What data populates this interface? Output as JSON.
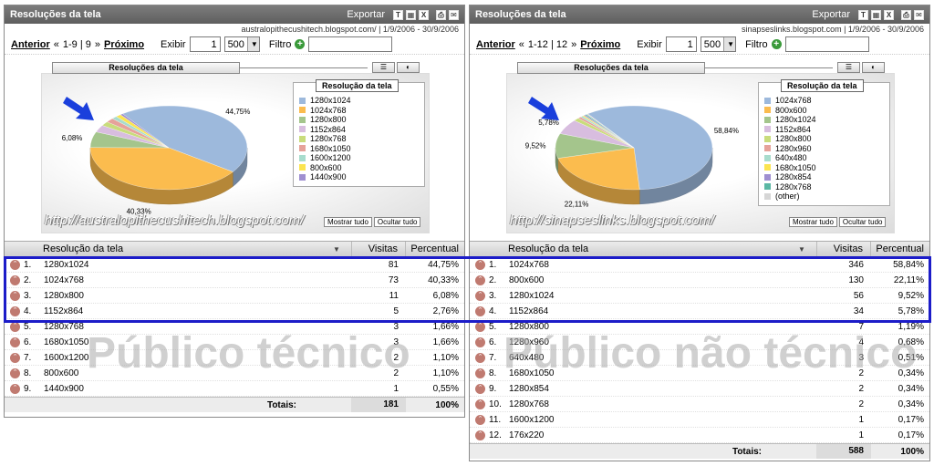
{
  "colors": {
    "highlight": "#1c1cc8",
    "arrow": "#1a3fdc",
    "pie_blue": "#9db9dc",
    "pie_orange": "#fbbc4e",
    "pie_green": "#a4c58c",
    "pie_lilac": "#d8bddf",
    "pie_yellowgreen": "#c9dc7c",
    "pie_salmon": "#e6a29a",
    "pie_mint": "#a8dccd",
    "pie_yellow": "#fbe450",
    "pie_purple": "#9f8fd0",
    "pie_teal": "#5bb8a4",
    "pie_grey": "#d6d6d6"
  },
  "panels": [
    {
      "title": "Resoluções da tela",
      "export_label": "Exportar",
      "toolbar_icons": [
        "text-export-icon",
        "chart-export-icon",
        "xls-export-icon",
        "print-icon",
        "email-icon"
      ],
      "site": "australopithecushitech.blogspot.com/",
      "date_range": "1/9/2006 - 30/9/2006",
      "nav": {
        "prev": "Anterior",
        "range": "1-9 | 9",
        "next": "Próximo",
        "show_label": "Exibir",
        "show_value": "1",
        "page_size": "500",
        "filter_label": "Filtro",
        "filter_value": ""
      },
      "chart_title": "Resoluções da tela",
      "legend_title": "Resolução da tela",
      "legend_buttons": [
        "Mostrar tudo",
        "Ocultar tudo"
      ],
      "watermark_url": "http://australopithecushitech.blogspot.com/",
      "slice_labels": [
        {
          "text": "44,75%"
        },
        {
          "text": "40,33%"
        },
        {
          "text": "6,08%"
        }
      ],
      "table_headers": {
        "name": "Resolução da tela",
        "visits": "Visitas",
        "percent": "Percentual"
      },
      "rows": [
        {
          "rank": "1.",
          "name": "1280x1024",
          "visits": "81",
          "pct": "44,75%"
        },
        {
          "rank": "2.",
          "name": "1024x768",
          "visits": "73",
          "pct": "40,33%"
        },
        {
          "rank": "3.",
          "name": "1280x800",
          "visits": "11",
          "pct": "6,08%"
        },
        {
          "rank": "4.",
          "name": "1152x864",
          "visits": "5",
          "pct": "2,76%"
        },
        {
          "rank": "5.",
          "name": "1280x768",
          "visits": "3",
          "pct": "1,66%"
        },
        {
          "rank": "6.",
          "name": "1680x1050",
          "visits": "3",
          "pct": "1,66%"
        },
        {
          "rank": "7.",
          "name": "1600x1200",
          "visits": "2",
          "pct": "1,10%"
        },
        {
          "rank": "8.",
          "name": "800x600",
          "visits": "2",
          "pct": "1,10%"
        },
        {
          "rank": "9.",
          "name": "1440x900",
          "visits": "1",
          "pct": "0,55%"
        }
      ],
      "totals": {
        "label": "Totais:",
        "visits": "181",
        "pct": "100%"
      },
      "big_label": "Público técnico"
    },
    {
      "title": "Resoluções da tela",
      "export_label": "Exportar",
      "toolbar_icons": [
        "text-export-icon",
        "chart-export-icon",
        "xls-export-icon",
        "print-icon",
        "email-icon"
      ],
      "site": "sinapseslinks.blogspot.com",
      "date_range": "1/9/2006 - 30/9/2006",
      "nav": {
        "prev": "Anterior",
        "range": "1-12 | 12",
        "next": "Próximo",
        "show_label": "Exibir",
        "show_value": "1",
        "page_size": "500",
        "filter_label": "Filtro",
        "filter_value": ""
      },
      "chart_title": "Resoluções da tela",
      "legend_title": "Resolução da tela",
      "legend_buttons": [
        "Mostrar tudo",
        "Ocultar tudo"
      ],
      "watermark_url": "http://sinapseslinks.blogspot.com/",
      "slice_labels": [
        {
          "text": "58,84%"
        },
        {
          "text": "22,11%"
        },
        {
          "text": "9,52%"
        },
        {
          "text": "5,78%"
        }
      ],
      "table_headers": {
        "name": "Resolução da tela",
        "visits": "Visitas",
        "percent": "Percentual"
      },
      "rows": [
        {
          "rank": "1.",
          "name": "1024x768",
          "visits": "346",
          "pct": "58,84%"
        },
        {
          "rank": "2.",
          "name": "800x600",
          "visits": "130",
          "pct": "22,11%"
        },
        {
          "rank": "3.",
          "name": "1280x1024",
          "visits": "56",
          "pct": "9,52%"
        },
        {
          "rank": "4.",
          "name": "1152x864",
          "visits": "34",
          "pct": "5,78%"
        },
        {
          "rank": "5.",
          "name": "1280x800",
          "visits": "7",
          "pct": "1,19%"
        },
        {
          "rank": "6.",
          "name": "1280x960",
          "visits": "4",
          "pct": "0,68%"
        },
        {
          "rank": "7.",
          "name": "640x480",
          "visits": "3",
          "pct": "0,51%"
        },
        {
          "rank": "8.",
          "name": "1680x1050",
          "visits": "2",
          "pct": "0,34%"
        },
        {
          "rank": "9.",
          "name": "1280x854",
          "visits": "2",
          "pct": "0,34%"
        },
        {
          "rank": "10.",
          "name": "1280x768",
          "visits": "2",
          "pct": "0,34%"
        },
        {
          "rank": "11.",
          "name": "1600x1200",
          "visits": "1",
          "pct": "0,17%"
        },
        {
          "rank": "12.",
          "name": "176x220",
          "visits": "1",
          "pct": "0,17%"
        }
      ],
      "totals": {
        "label": "Totais:",
        "visits": "588",
        "pct": "100%"
      },
      "big_label": "Público não técnico"
    }
  ],
  "chart_data": [
    {
      "type": "pie",
      "title": "Resoluções da tela",
      "legend_title": "Resolução da tela",
      "legend_placement": "right",
      "categories": [
        "1280x1024",
        "1024x768",
        "1280x800",
        "1152x864",
        "1280x768",
        "1680x1050",
        "1600x1200",
        "800x600",
        "1440x900"
      ],
      "values": [
        44.75,
        40.33,
        6.08,
        2.76,
        1.66,
        1.66,
        1.1,
        1.1,
        0.55
      ],
      "colors": [
        "#9db9dc",
        "#fbbc4e",
        "#a4c58c",
        "#d8bddf",
        "#c9dc7c",
        "#e6a29a",
        "#a8dccd",
        "#fbe450",
        "#9f8fd0"
      ]
    },
    {
      "type": "pie",
      "title": "Resoluções da tela",
      "legend_title": "Resolução da tela",
      "legend_placement": "right",
      "categories": [
        "1024x768",
        "800x600",
        "1280x1024",
        "1152x864",
        "1280x800",
        "1280x960",
        "640x480",
        "1680x1050",
        "1280x854",
        "1280x768",
        "(other)"
      ],
      "values": [
        58.84,
        22.11,
        9.52,
        5.78,
        1.19,
        0.68,
        0.51,
        0.34,
        0.34,
        0.34,
        0.34
      ],
      "colors": [
        "#9db9dc",
        "#fbbc4e",
        "#a4c58c",
        "#d8bddf",
        "#c9dc7c",
        "#e6a29a",
        "#a8dccd",
        "#fbe450",
        "#9f8fd0",
        "#5bb8a4",
        "#d6d6d6"
      ]
    }
  ]
}
